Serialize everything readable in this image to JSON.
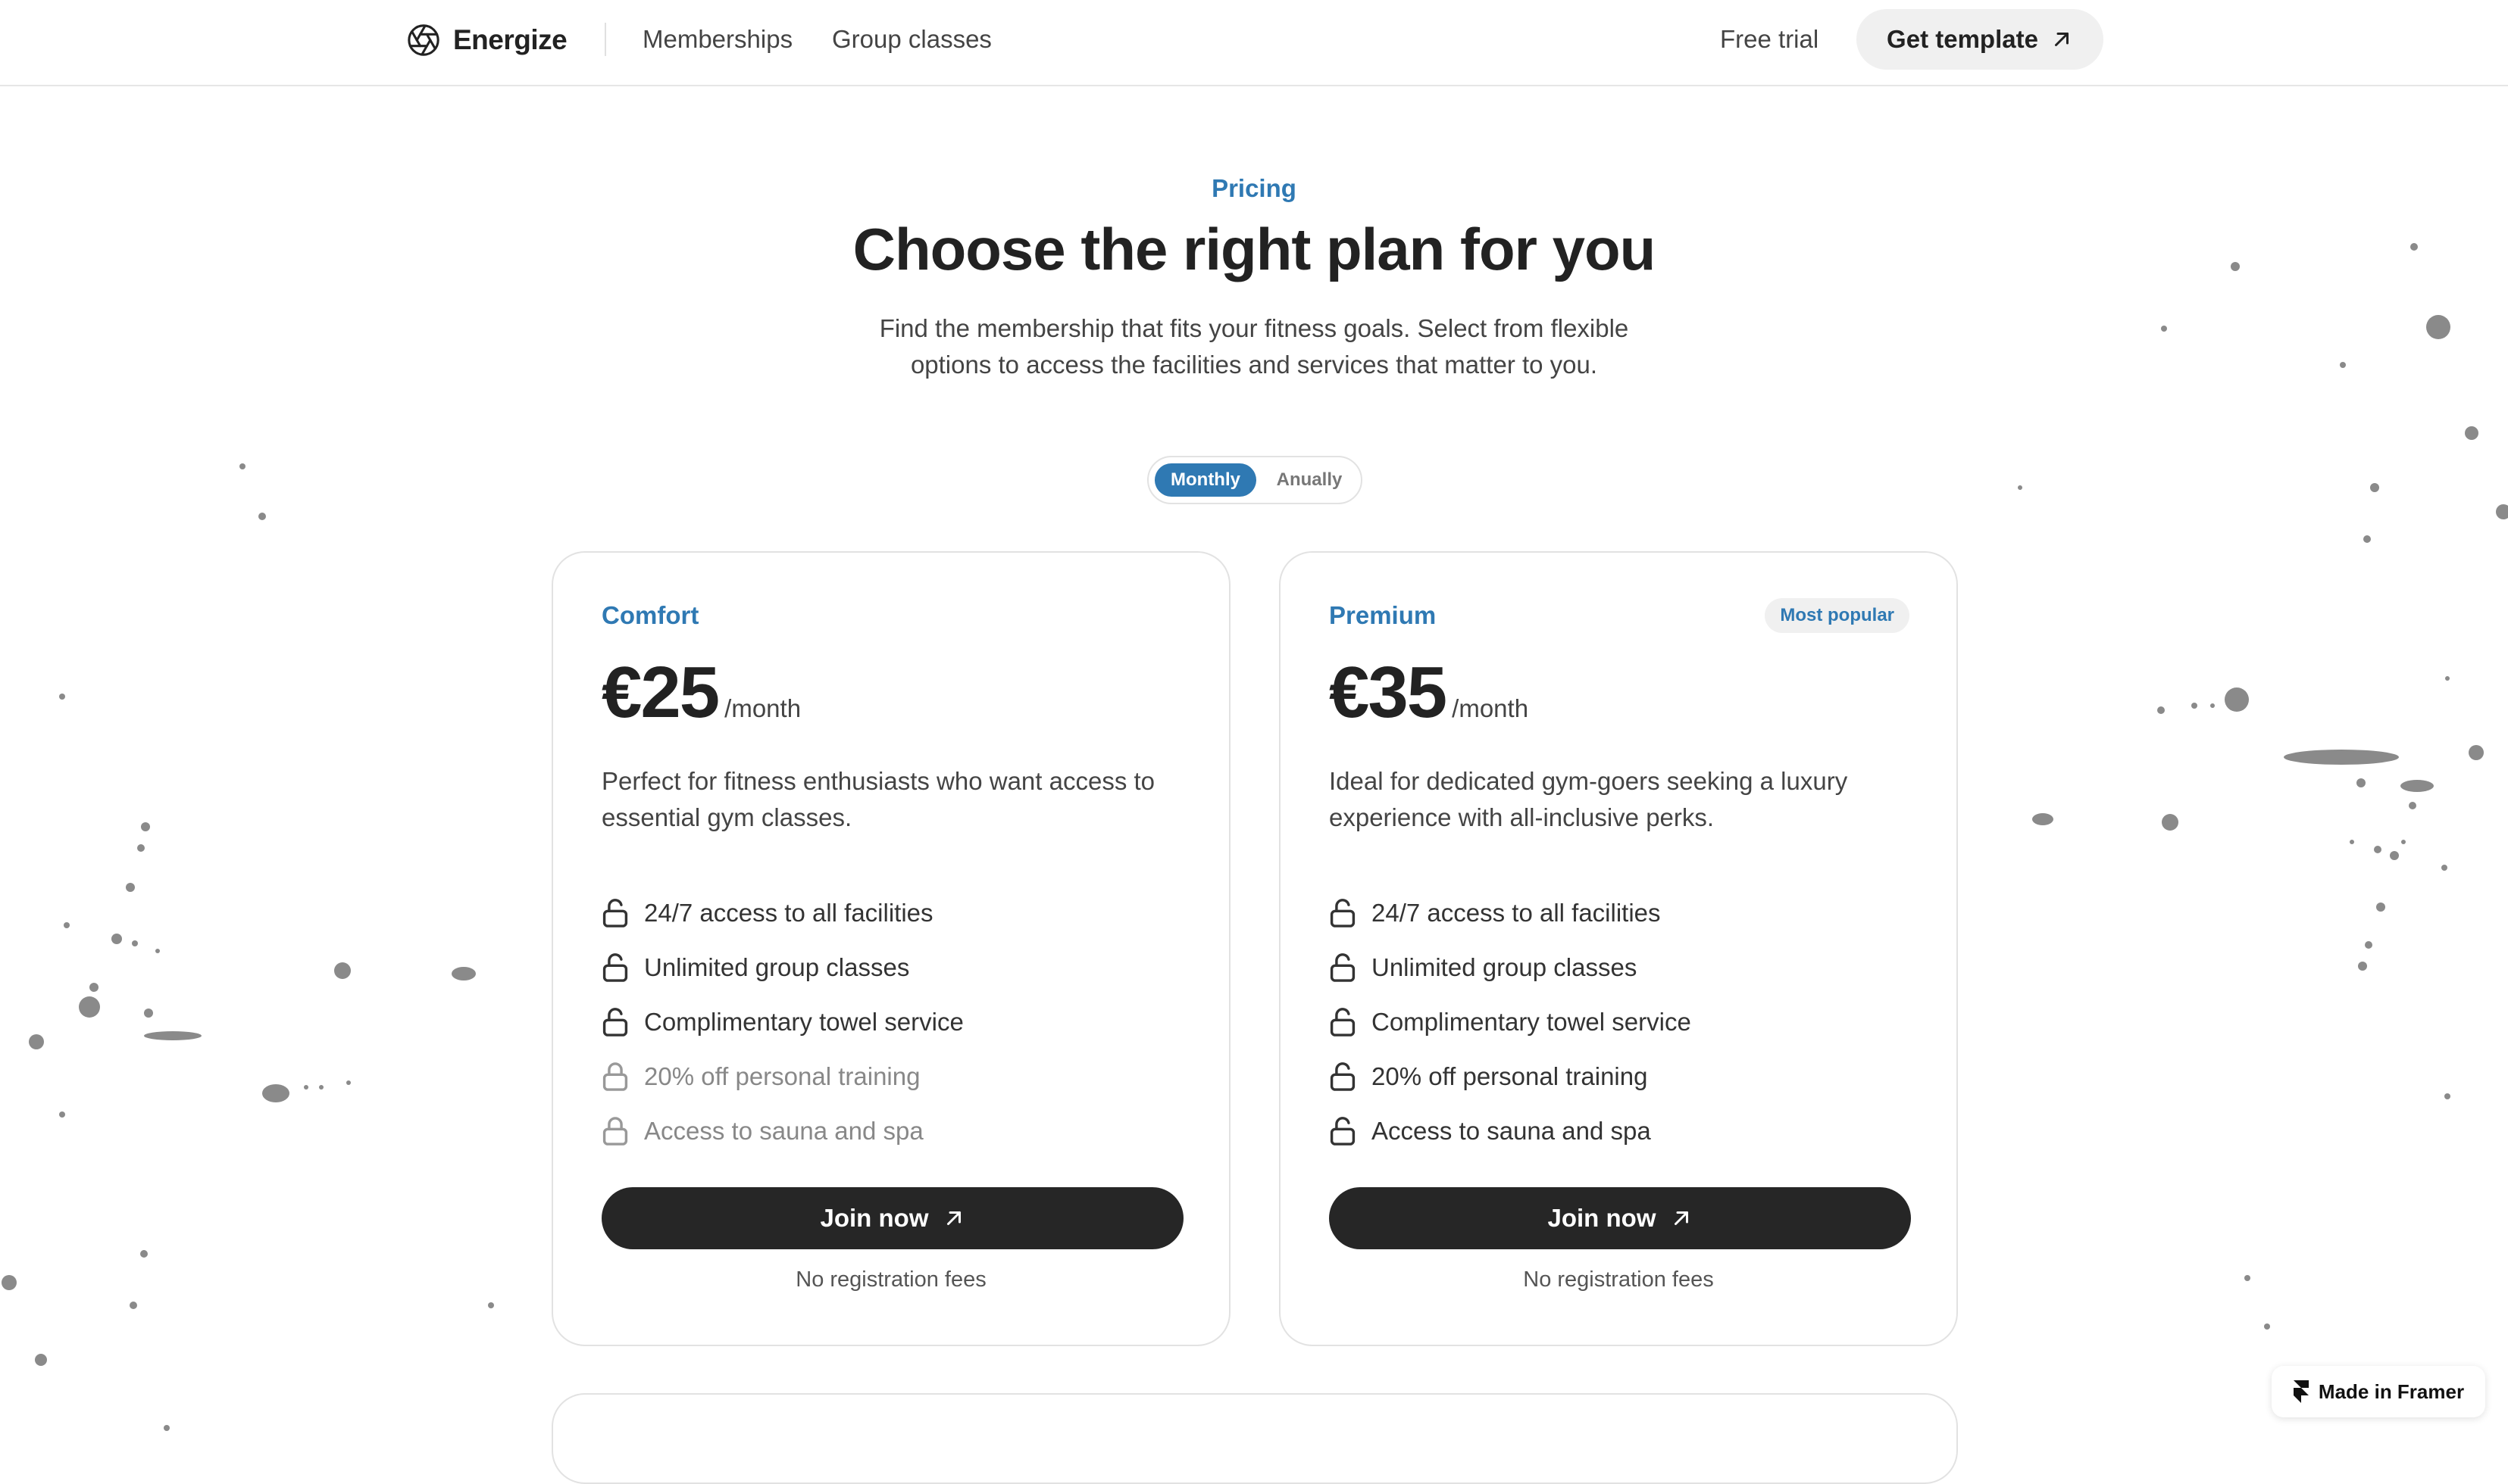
{
  "nav": {
    "brand": "Energize",
    "links": [
      "Memberships",
      "Group classes"
    ],
    "free_trial": "Free trial",
    "cta": "Get template"
  },
  "hero": {
    "eyebrow": "Pricing",
    "title": "Choose the right plan for you",
    "subtitle": "Find the membership that fits your fitness goals. Select from flexible options to access the facilities and services that matter to you."
  },
  "billing_toggle": {
    "options": [
      "Monthly",
      "Anually"
    ],
    "selected": "Monthly"
  },
  "plans": [
    {
      "name": "Comfort",
      "price": "€25",
      "period": "/month",
      "description": "Perfect for fitness enthusiasts who want access to essential gym classes.",
      "features": [
        {
          "label": "24/7 access to all facilities",
          "included": true
        },
        {
          "label": "Unlimited group classes",
          "included": true
        },
        {
          "label": "Complimentary towel service",
          "included": true
        },
        {
          "label": "20% off personal training",
          "included": false
        },
        {
          "label": "Access to sauna and spa",
          "included": false
        }
      ],
      "cta": "Join now",
      "note": "No registration fees"
    },
    {
      "name": "Premium",
      "badge": "Most popular",
      "price": "€35",
      "period": "/month",
      "description": "Ideal for dedicated gym-goers seeking a luxury experience with all-inclusive perks.",
      "features": [
        {
          "label": "24/7 access to all facilities",
          "included": true
        },
        {
          "label": "Unlimited group classes",
          "included": true
        },
        {
          "label": "Complimentary towel service",
          "included": true
        },
        {
          "label": "20% off personal training",
          "included": true
        },
        {
          "label": "Access to sauna and spa",
          "included": true
        }
      ],
      "cta": "Join now",
      "note": "No registration fees"
    }
  ],
  "framer_badge": "Made in Framer",
  "colors": {
    "accent": "#2f79b3",
    "text": "#222222",
    "button": "#262626",
    "muted": "#888888"
  }
}
